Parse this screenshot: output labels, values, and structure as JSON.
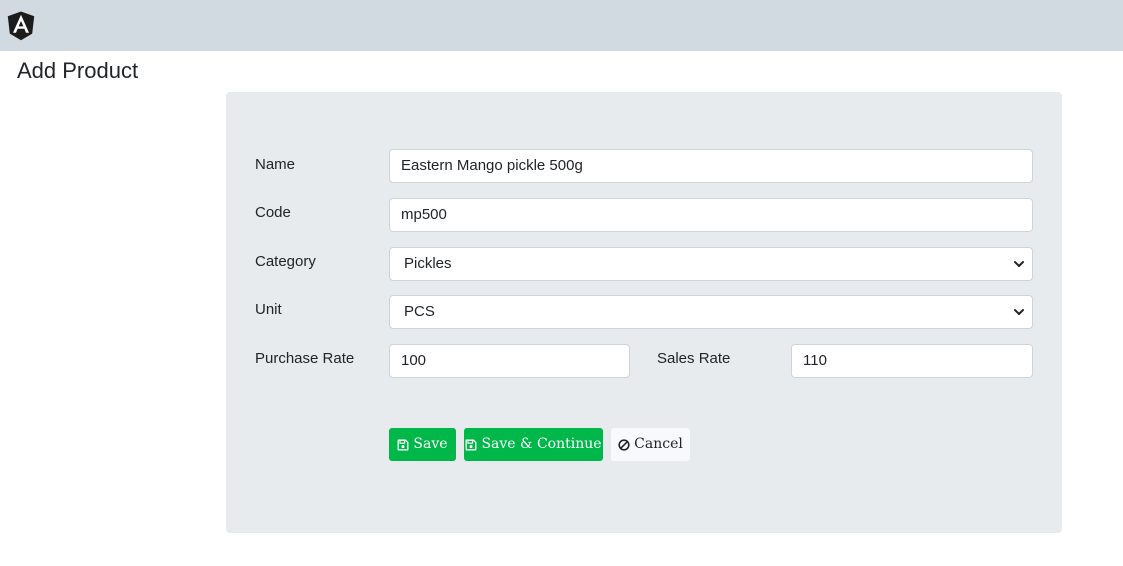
{
  "navbar": {
    "logo_icon": "angular-logo-icon",
    "background_color": "#d1dae1"
  },
  "page": {
    "title": "Add Product"
  },
  "form": {
    "name": {
      "label": "Name",
      "value": "Eastern Mango pickle 500g"
    },
    "code": {
      "label": "Code",
      "value": "mp500"
    },
    "category": {
      "label": "Category",
      "selected": "Pickles",
      "icon": "chevron-down-icon"
    },
    "unit": {
      "label": "Unit",
      "selected": "PCS",
      "icon": "chevron-down-icon"
    },
    "purchase_rate": {
      "label": "Purchase Rate",
      "value": "100"
    },
    "sales_rate": {
      "label": "Sales Rate",
      "value": "110"
    }
  },
  "buttons": {
    "save": {
      "label": "Save",
      "icon": "floppy-disk-icon"
    },
    "save_continue": {
      "label": "Save & Continue",
      "icon": "floppy-disk-icon"
    },
    "cancel": {
      "label": "Cancel",
      "icon": "ban-icon"
    }
  },
  "colors": {
    "success": "#00b74a",
    "card_background": "#e7ebee"
  }
}
